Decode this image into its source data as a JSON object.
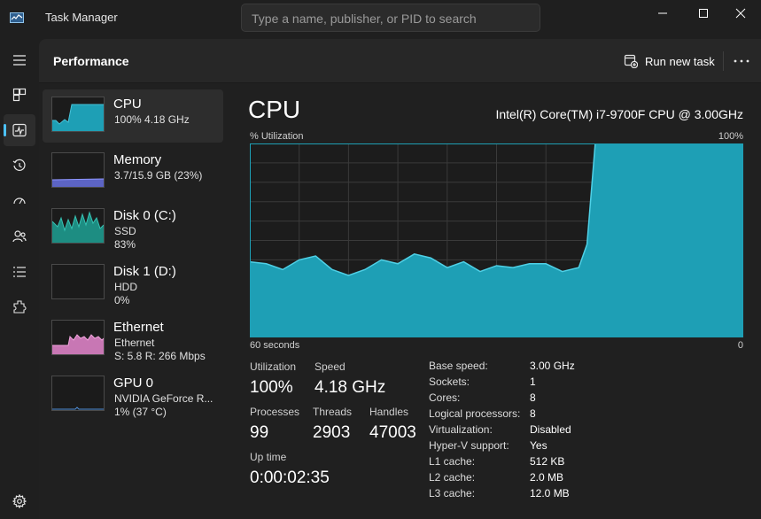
{
  "window": {
    "title": "Task Manager",
    "search_placeholder": "Type a name, publisher, or PID to search"
  },
  "nav": {
    "items": [
      {
        "icon": "hamburger-menu-icon",
        "active": false
      },
      {
        "icon": "processes-icon",
        "active": false
      },
      {
        "icon": "performance-icon",
        "active": true
      },
      {
        "icon": "app-history-icon",
        "active": false
      },
      {
        "icon": "startup-apps-icon",
        "active": false
      },
      {
        "icon": "users-icon",
        "active": false
      },
      {
        "icon": "details-icon",
        "active": false
      },
      {
        "icon": "services-icon",
        "active": false
      }
    ],
    "settings_icon": "settings-gear-icon"
  },
  "header": {
    "title": "Performance",
    "run_new_task": "Run new task",
    "more_icon": "more-options-icon"
  },
  "devices": [
    {
      "name": "CPU",
      "line2": "100%  4.18 GHz",
      "line3": "",
      "color": "#1e9fb5",
      "usage_pct": 100
    },
    {
      "name": "Memory",
      "line2": "3.7/15.9 GB (23%)",
      "line3": "",
      "color": "#6b75d8",
      "usage_pct": 23
    },
    {
      "name": "Disk 0 (C:)",
      "line2": "SSD",
      "line3": "83%",
      "color": "#22a396",
      "usage_pct": 83
    },
    {
      "name": "Disk 1 (D:)",
      "line2": "HDD",
      "line3": "0%",
      "color": "#22a396",
      "usage_pct": 0
    },
    {
      "name": "Ethernet",
      "line2": "Ethernet",
      "line3": "S: 5.8  R: 266 Mbps",
      "color": "#d97fc4",
      "usage_pct": null
    },
    {
      "name": "GPU 0",
      "line2": "NVIDIA GeForce R...",
      "line3": "1%  (37 °C)",
      "color": "#2e6fb8",
      "usage_pct": 1
    }
  ],
  "detail": {
    "title": "CPU",
    "model": "Intel(R) Core(TM) i7-9700F CPU @ 3.00GHz",
    "graph_label": "% Utilization",
    "graph_max_label": "100%",
    "graph_time_label": "60 seconds",
    "graph_min_label": "0"
  },
  "chart_data": {
    "type": "area",
    "title": "",
    "xlabel": "60 seconds",
    "ylabel": "% Utilization",
    "xlim": [
      60,
      0
    ],
    "ylim": [
      0,
      100
    ],
    "grid": true,
    "x": [
      60,
      58,
      56,
      54,
      52,
      50,
      48,
      46,
      44,
      42,
      40,
      38,
      36,
      34,
      32,
      30,
      28,
      26,
      24,
      22,
      20,
      19,
      18,
      16,
      0
    ],
    "values": [
      39,
      38,
      35,
      40,
      42,
      35,
      32,
      35,
      40,
      38,
      43,
      41,
      36,
      39,
      34,
      37,
      36,
      38,
      38,
      34,
      36,
      48,
      100,
      100,
      100
    ],
    "color": "#1e9fb5"
  },
  "stats": {
    "utilization": {
      "label": "Utilization",
      "value": "100%"
    },
    "speed": {
      "label": "Speed",
      "value": "4.18 GHz"
    },
    "processes": {
      "label": "Processes",
      "value": "99"
    },
    "threads": {
      "label": "Threads",
      "value": "2903"
    },
    "handles": {
      "label": "Handles",
      "value": "47003"
    },
    "uptime": {
      "label": "Up time",
      "value": "0:00:02:35"
    }
  },
  "specs": [
    {
      "key": "Base speed:",
      "value": "3.00 GHz"
    },
    {
      "key": "Sockets:",
      "value": "1"
    },
    {
      "key": "Cores:",
      "value": "8"
    },
    {
      "key": "Logical processors:",
      "value": "8"
    },
    {
      "key": "Virtualization:",
      "value": "Disabled"
    },
    {
      "key": "Hyper-V support:",
      "value": "Yes"
    },
    {
      "key": "L1 cache:",
      "value": "512 KB"
    },
    {
      "key": "L2 cache:",
      "value": "2.0 MB"
    },
    {
      "key": "L3 cache:",
      "value": "12.0 MB"
    }
  ]
}
